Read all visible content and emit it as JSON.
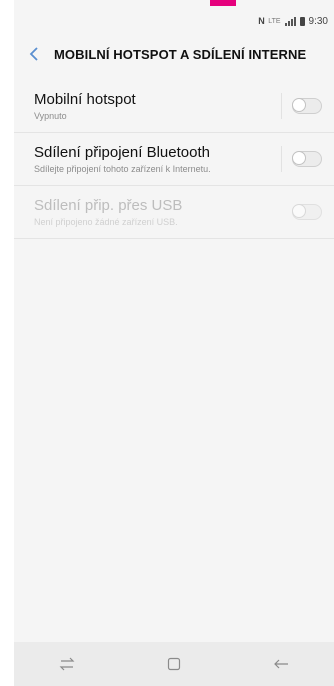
{
  "status_bar": {
    "nfc": "N",
    "network": "LTE",
    "time": "9:30"
  },
  "header": {
    "back_icon": "chevron-left-icon",
    "title": "MOBILNÍ HOTSPOT A SDÍLENÍ INTERNE"
  },
  "settings": [
    {
      "label": "Mobilní hotspot",
      "subtitle": "Vypnuto",
      "enabled": true,
      "toggle_on": false
    },
    {
      "label": "Sdílení připojení Bluetooth",
      "subtitle": "Sdílejte připojení tohoto zařízení k Internetu.",
      "enabled": true,
      "toggle_on": false
    },
    {
      "label": "Sdílení přip. přes USB",
      "subtitle": "Není připojeno žádné zařízení USB.",
      "enabled": false,
      "toggle_on": false
    }
  ],
  "navigation_bar": {
    "icons": [
      "recent-apps-icon",
      "home-icon",
      "back-icon"
    ]
  },
  "colors": {
    "accent": "#5a8fd0",
    "brand_mark": "#e5007d"
  }
}
